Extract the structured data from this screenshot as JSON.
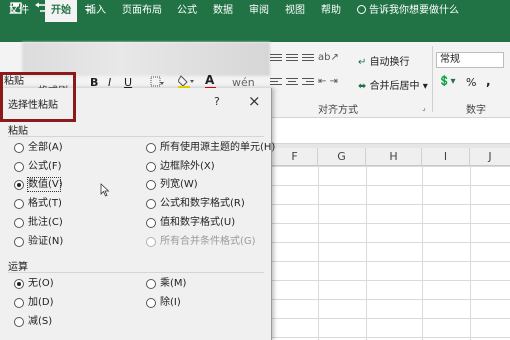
{
  "tabs": [
    "文件",
    "开始",
    "插入",
    "页面布局",
    "公式",
    "数据",
    "审阅",
    "视图",
    "帮助"
  ],
  "active_tab": "开始",
  "tell_me": "告诉我你想要做什么",
  "ribbon": {
    "paste_label": "粘贴",
    "format_painter": "格式刷",
    "font_bold": "B",
    "font_italic": "I",
    "font_underline": "U",
    "font_color": "A",
    "wrap_text": "自动换行",
    "merge_center": "合并后居中",
    "alignment_group": "对齐方式",
    "number_group": "数字",
    "number_format": "常规",
    "percent": "%",
    "comma": ","
  },
  "columns": [
    "F",
    "G",
    "H",
    "I",
    "J"
  ],
  "dialog": {
    "title": "选择性粘贴",
    "help": "?",
    "close": "×",
    "paste_section": "粘贴",
    "operation_section": "运算",
    "paste_options_left": [
      {
        "label": "全部(A)",
        "checked": false
      },
      {
        "label": "公式(F)",
        "checked": false
      },
      {
        "label": "数值(V)",
        "checked": true
      },
      {
        "label": "格式(T)",
        "checked": false
      },
      {
        "label": "批注(C)",
        "checked": false
      },
      {
        "label": "验证(N)",
        "checked": false
      }
    ],
    "paste_options_right": [
      {
        "label": "所有使用源主题的单元(H)",
        "checked": false,
        "disabled": false
      },
      {
        "label": "边框除外(X)",
        "checked": false,
        "disabled": false
      },
      {
        "label": "列宽(W)",
        "checked": false,
        "disabled": false
      },
      {
        "label": "公式和数字格式(R)",
        "checked": false,
        "disabled": false
      },
      {
        "label": "值和数字格式(U)",
        "checked": false,
        "disabled": false
      },
      {
        "label": "所有合并条件格式(G)",
        "checked": false,
        "disabled": true
      }
    ],
    "operation_options_left": [
      {
        "label": "无(O)",
        "checked": true
      },
      {
        "label": "加(D)",
        "checked": false
      },
      {
        "label": "减(S)",
        "checked": false
      }
    ],
    "operation_options_right": [
      {
        "label": "乘(M)",
        "checked": false
      },
      {
        "label": "除(I)",
        "checked": false
      }
    ]
  },
  "colors": {
    "excel_green": "#217346",
    "highlight_red": "#8b1a1a"
  }
}
